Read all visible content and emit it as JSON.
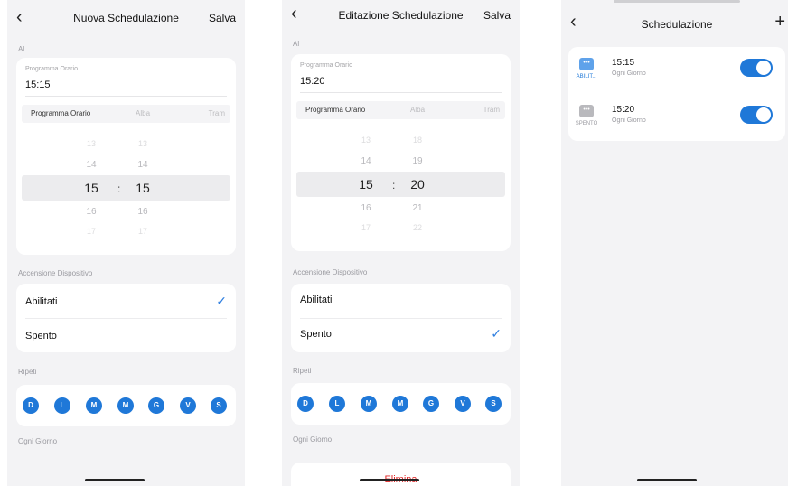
{
  "screen1": {
    "back_icon": "chevron-left-icon",
    "title": "Nuova Schedulazione",
    "save_label": "Salva",
    "section_al": "Al",
    "field_label": "Programma Orario",
    "field_value": "15:15",
    "tabs": [
      "Programma Orario",
      "Alba",
      "Tram"
    ],
    "hours": [
      "13",
      "14",
      "15",
      "16",
      "17"
    ],
    "minutes": [
      "13",
      "14",
      "15",
      "16",
      "17"
    ],
    "separator": ":",
    "section_device": "Accensione Dispositivo",
    "options": [
      "Abilitati",
      "Spento"
    ],
    "selected_option": "Abilitati",
    "check_icon": "checkmark-icon",
    "section_repeat": "Ripeti",
    "days": [
      "D",
      "L",
      "M",
      "M",
      "G",
      "V",
      "S"
    ],
    "repeat_summary": "Ogni Giorno"
  },
  "screen2": {
    "back_icon": "chevron-left-icon",
    "title": "Editazione Schedulazione",
    "save_label": "Salva",
    "section_al": "Al",
    "field_label": "Programma Orario",
    "field_value": "15:20",
    "tabs": [
      "Programma Orario",
      "Alba",
      "Tram"
    ],
    "hours": [
      "13",
      "14",
      "15",
      "16",
      "17"
    ],
    "minutes": [
      "18",
      "19",
      "20",
      "21",
      "22"
    ],
    "separator": ":",
    "section_device": "Accensione Dispositivo",
    "options": [
      "Abilitati",
      "Spento"
    ],
    "selected_option": "Spento",
    "check_icon": "checkmark-icon",
    "section_repeat": "Ripeti",
    "days": [
      "D",
      "L",
      "M",
      "M",
      "G",
      "V",
      "S"
    ],
    "repeat_summary": "Ogni Giorno",
    "delete_label": "Elimina"
  },
  "screen3": {
    "back_icon": "chevron-left-icon",
    "title": "Schedulazione",
    "add_icon": "plus-icon",
    "items": [
      {
        "time": "15:15",
        "repeat": "Ogni Giorno",
        "device_label": "ABILIT...",
        "enabled": true
      },
      {
        "time": "15:20",
        "repeat": "Ogni Giorno",
        "device_label": "SPENTO",
        "enabled": true
      }
    ]
  },
  "colors": {
    "accent": "#1f78d8",
    "background": "#f3f3f5",
    "danger": "#e02525",
    "card": "#ffffff"
  }
}
